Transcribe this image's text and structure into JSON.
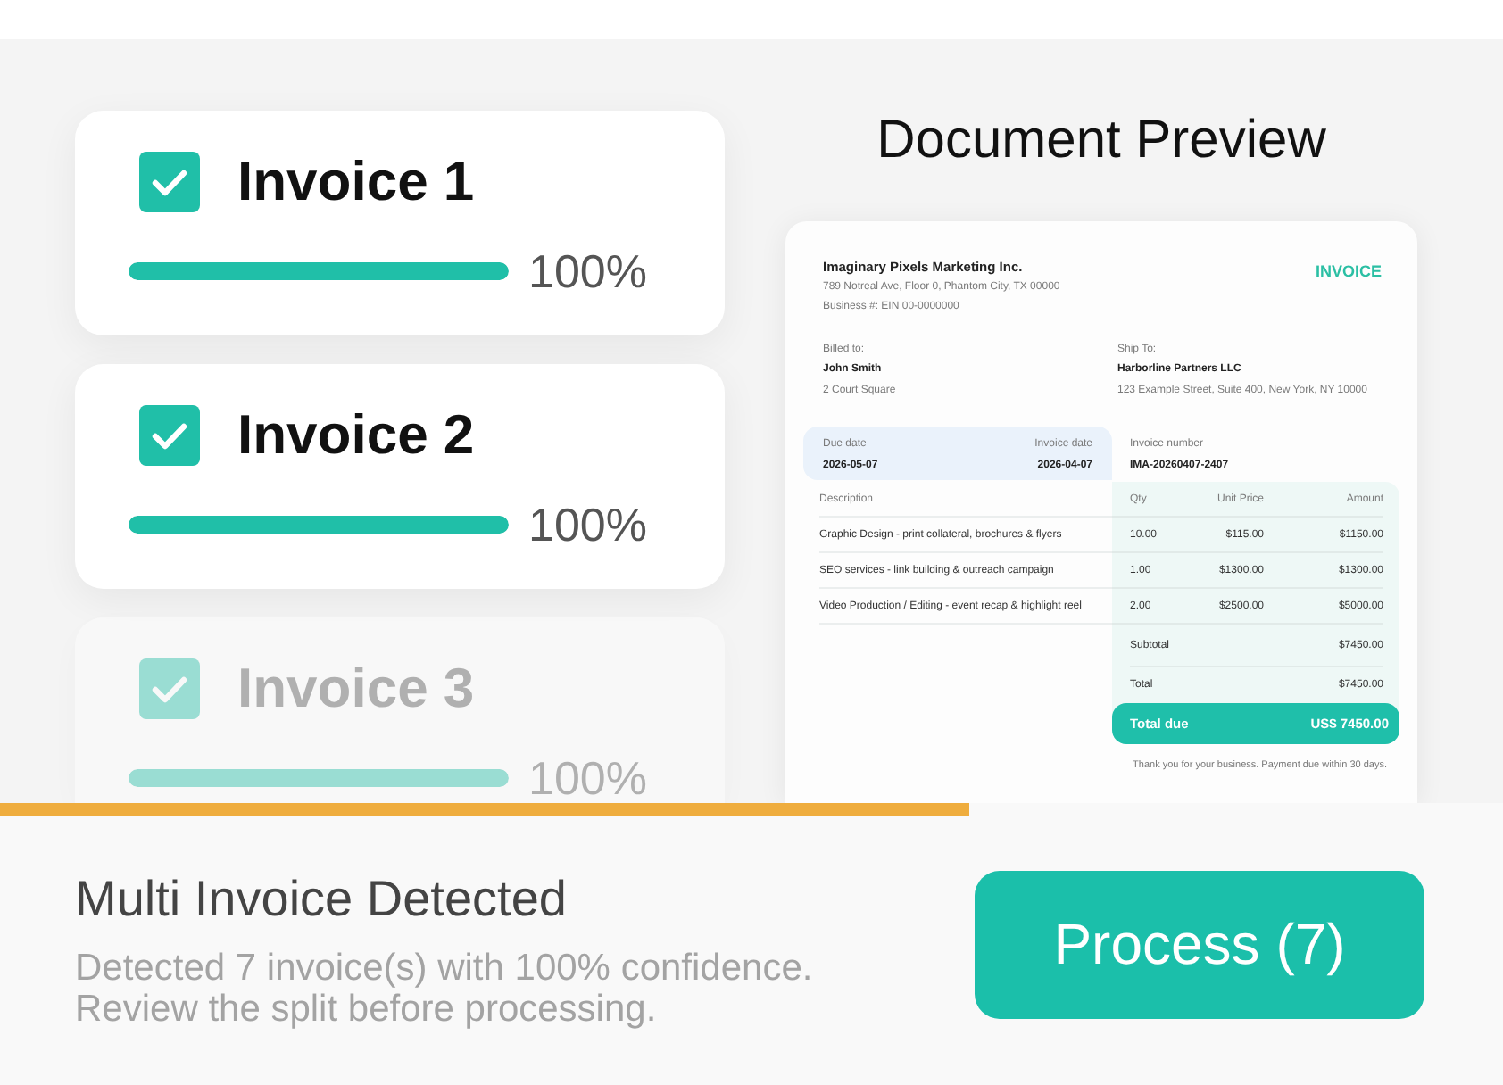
{
  "invoices": [
    {
      "label": "Invoice 1",
      "checked": true,
      "level": 1,
      "percent": "100%",
      "faded": false
    },
    {
      "label": "Invoice 2",
      "checked": true,
      "level": 1,
      "percent": "100%",
      "faded": false
    },
    {
      "label": "Invoice 3",
      "checked": true,
      "level": 1,
      "percent": "100%",
      "faded": true
    }
  ],
  "preview": {
    "title": "Document Preview",
    "document": {
      "company": "Imaginary Pixels Marketing Inc.",
      "address": "789 Notreal Ave, Floor 0, Phantom City, TX 00000",
      "business_number": "Business #: EIN 00-0000000",
      "doc_type": "INVOICE",
      "billed_to": {
        "label": "Billed to:",
        "name": "John Smith",
        "address": "2 Court Square"
      },
      "ship_to": {
        "label": "Ship To:",
        "name": "Harborline Partners LLC",
        "address": "123 Example Street, Suite 400, New York, NY 10000"
      },
      "due_date": {
        "label": "Due date",
        "value": "2026-05-07"
      },
      "invoice_date": {
        "label": "Invoice date",
        "value": "2026-04-07"
      },
      "invoice_number": {
        "label": "Invoice number",
        "value": "IMA-20260407-2407"
      },
      "table": {
        "columns": [
          "Description",
          "Qty",
          "Unit Price",
          "Amount"
        ],
        "rows": [
          [
            "Graphic Design - print collateral, brochures & flyers",
            "10.00",
            "$115.00",
            "$1150.00"
          ],
          [
            "SEO services - link building & outreach campaign",
            "1.00",
            "$1300.00",
            "$1300.00"
          ],
          [
            "Video Production / Editing - event recap & highlight reel",
            "2.00",
            "$2500.00",
            "$5000.00"
          ]
        ]
      },
      "totals": [
        {
          "kind": "line",
          "label": "Subtotal",
          "value": "$7450.00"
        },
        {
          "kind": "line",
          "label": "Total",
          "value": "$7450.00"
        },
        {
          "kind": "due",
          "label": "Total due",
          "value": "US$ 7450.00"
        }
      ],
      "footer": "Thank you for your business. Payment due within 30 days."
    }
  },
  "progress": {
    "level": 0.645
  },
  "summary": {
    "title": "Multi Invoice Detected",
    "lines": [
      "Detected 7 invoice(s) with 100% confidence.",
      "Review the split before processing."
    ],
    "button": "Process (7)"
  }
}
